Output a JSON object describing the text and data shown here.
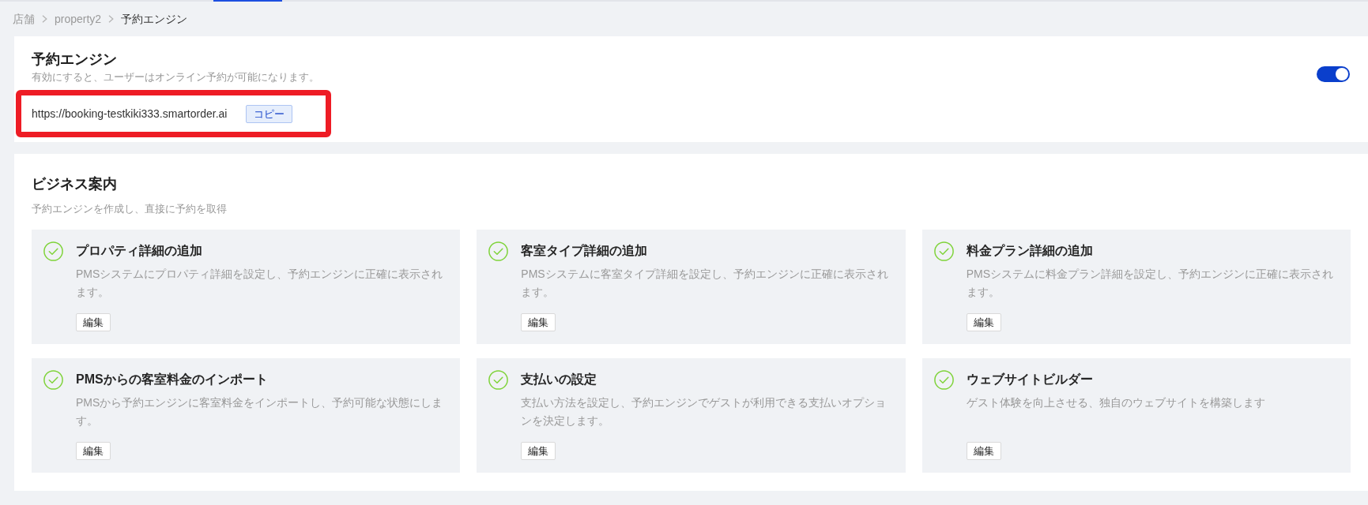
{
  "breadcrumb": [
    {
      "label": "店舗",
      "current": false
    },
    {
      "label": "property2",
      "current": false
    },
    {
      "label": "予約エンジン",
      "current": true
    }
  ],
  "booking_engine": {
    "title": "予約エンジン",
    "description": "有効にすると、ユーザーはオンライン予約が可能になります。",
    "enabled": true,
    "highlighted": true,
    "url": "https://booking-testkiki333.smartorder.ai",
    "copy_button": "コピー"
  },
  "business_guide": {
    "title": "ビジネス案内",
    "description": "予約エンジンを作成し、直接に予約を取得",
    "steps": [
      {
        "title": "プロパティ詳細の追加",
        "description": "PMSシステムにプロパティ詳細を設定し、予約エンジンに正確に表示されます。",
        "done": true,
        "button": "編集"
      },
      {
        "title": "客室タイプ詳細の追加",
        "description": "PMSシステムに客室タイプ詳細を設定し、予約エンジンに正確に表示されます。",
        "done": true,
        "button": "編集"
      },
      {
        "title": "料金プラン詳細の追加",
        "description": "PMSシステムに料金プラン詳細を設定し、予約エンジンに正確に表示されます。",
        "done": true,
        "button": "編集"
      },
      {
        "title": "PMSからの客室料金のインポート",
        "description": "PMSから予約エンジンに客室料金をインポートし、予約可能な状態にします。",
        "done": true,
        "button": "編集"
      },
      {
        "title": "支払いの設定",
        "description": "支払い方法を設定し、予約エンジンでゲストが利用できる支払いオプションを決定します。",
        "done": true,
        "button": "編集"
      },
      {
        "title": "ウェブサイトビルダー",
        "description": "ゲスト体験を向上させる、独自のウェブサイトを構築します",
        "done": true,
        "button": "編集"
      }
    ]
  }
}
